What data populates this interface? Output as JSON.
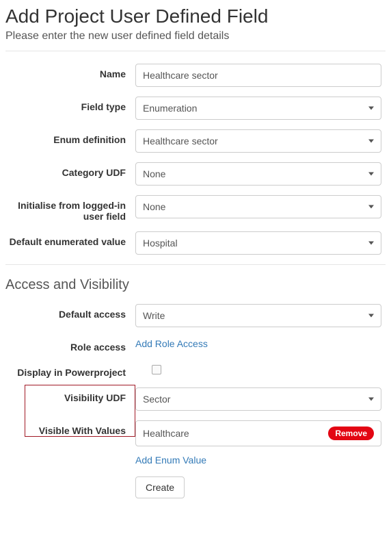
{
  "header": {
    "title": "Add Project User Defined Field",
    "subtitle": "Please enter the new user defined field details"
  },
  "labels": {
    "name": "Name",
    "field_type": "Field type",
    "enum_definition": "Enum definition",
    "category_udf": "Category UDF",
    "init_from": "Initialise from logged-in user field",
    "default_enum": "Default enumerated value",
    "section_access": "Access and Visibility",
    "default_access": "Default access",
    "role_access": "Role access",
    "display_pp": "Display in Powerproject",
    "visibility_udf": "Visibility UDF",
    "visible_with": "Visible With Values"
  },
  "values": {
    "name": "Healthcare sector",
    "field_type": "Enumeration",
    "enum_definition": "Healthcare sector",
    "category_udf": "None",
    "init_from": "None",
    "default_enum": "Hospital",
    "default_access": "Write",
    "visibility_udf": "Sector",
    "visible_value": "Healthcare"
  },
  "actions": {
    "add_role_access": "Add Role Access",
    "remove": "Remove",
    "add_enum_value": "Add Enum Value",
    "create": "Create"
  }
}
